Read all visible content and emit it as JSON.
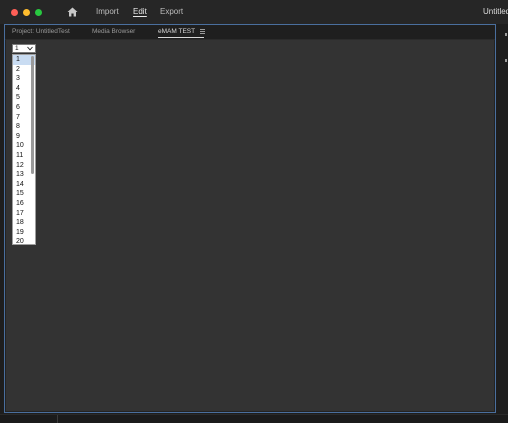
{
  "window": {
    "title": "Untitled"
  },
  "nav": {
    "import_label": "Import",
    "edit_label": "Edit",
    "export_label": "Export"
  },
  "tabs": [
    {
      "label": "Project: UntitledTest"
    },
    {
      "label": "Media Browser"
    },
    {
      "label": "eMAM TEST"
    }
  ],
  "dropdown": {
    "selected": "1",
    "options": [
      "1",
      "2",
      "3",
      "4",
      "5",
      "6",
      "7",
      "8",
      "9",
      "10",
      "11",
      "12",
      "13",
      "14",
      "15",
      "16",
      "17",
      "18",
      "19",
      "20"
    ]
  },
  "icons": {
    "home": "home-icon",
    "panel_menu": "panel-menu-icon",
    "dropdown_chevron": "chevron-down-icon"
  },
  "colors": {
    "accent": "#4a6f9e",
    "highlight": "#c9dcf2",
    "traffic_red": "#fe5f57",
    "traffic_yellow": "#febc2e",
    "traffic_green": "#28c840"
  }
}
